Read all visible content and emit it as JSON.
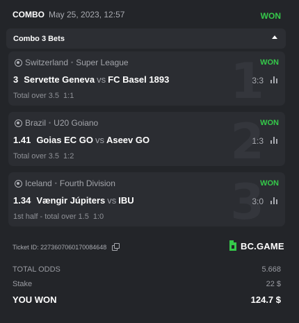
{
  "header": {
    "label": "COMBO",
    "date": "May 25, 2023, 12:57",
    "status": "WON"
  },
  "bets_bar": {
    "label": "Combo 3 Bets"
  },
  "legs": [
    {
      "country": "Switzerland",
      "league": "Super League",
      "status": "WON",
      "odds": "3",
      "home": "Servette Geneva",
      "vs": "vs",
      "away": "FC Basel 1893",
      "score": "3:3",
      "market": "Total over 3.5",
      "selection": "1:1",
      "index": "1"
    },
    {
      "country": "Brazil",
      "league": "U20 Goiano",
      "status": "WON",
      "odds": "1.41",
      "home": "Goias EC GO",
      "vs": "vs",
      "away": "Aseev GO",
      "score": "1:3",
      "market": "Total over 3.5",
      "selection": "1:2",
      "index": "2"
    },
    {
      "country": "Iceland",
      "league": "Fourth Division",
      "status": "WON",
      "odds": "1.34",
      "home": "Vængir Júpiters",
      "vs": "vs",
      "away": "IBU",
      "score": "3:0",
      "market": "1st half - total over 1.5",
      "selection": "1:0",
      "index": "3"
    }
  ],
  "ticket": {
    "label": "Ticket ID: 2273607060170084648"
  },
  "brand": {
    "name": "BC.GAME",
    "color": "#35c94a"
  },
  "summary": {
    "total_odds_label": "TOTAL ODDS",
    "total_odds_value": "5.668",
    "stake_label": "Stake",
    "stake_value": "22 $",
    "won_label": "YOU WON",
    "won_value": "124.7 $"
  },
  "colors": {
    "accent_green": "#35c94a",
    "background": "#232529",
    "leg_background": "#2b2d32"
  }
}
